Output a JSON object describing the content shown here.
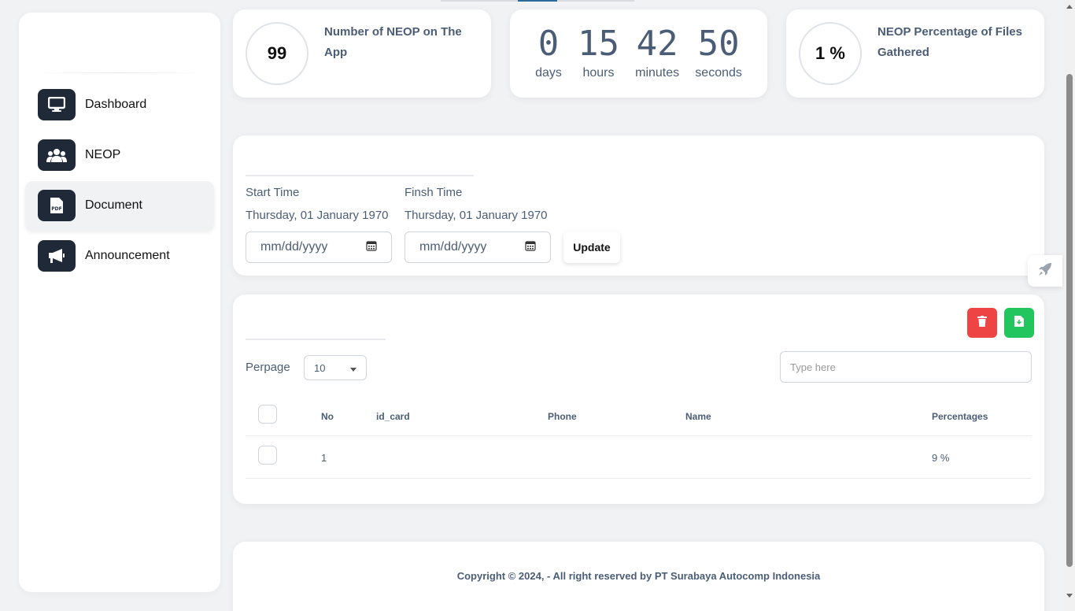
{
  "sidebar": {
    "items": [
      {
        "label": "Dashboard",
        "icon": "monitor-icon"
      },
      {
        "label": "NEOP",
        "icon": "users-icon"
      },
      {
        "label": "Document",
        "icon": "pdf-file-icon",
        "active": true
      },
      {
        "label": "Announcement",
        "icon": "megaphone-icon"
      }
    ]
  },
  "stats": {
    "neop_count": "99",
    "neop_count_title": "Number of NEOP on The App",
    "percentage": "1 %",
    "percentage_title": "NEOP Percentage of Files Gathered"
  },
  "countdown": {
    "days": "0",
    "days_label": "days",
    "hours": "15",
    "hours_label": "hours",
    "minutes": "42",
    "minutes_label": "minutes",
    "seconds": "50",
    "seconds_label": "seconds"
  },
  "filter": {
    "start_label": "Start Time",
    "start_value": "Thursday, 01 January 1970",
    "finish_label": "Finsh Time",
    "finish_value": "Thursday, 01 January 1970",
    "start_placeholder": "mm/dd/yyyy",
    "finish_placeholder": "mm/dd/yyyy",
    "update_label": "Update"
  },
  "table": {
    "perpage_label": "Perpage",
    "perpage_value": "10",
    "search_placeholder": "Type here",
    "columns": [
      "No",
      "id_card",
      "Phone",
      "Name",
      "Percentages"
    ],
    "rows": [
      {
        "no": "1",
        "id_card": "",
        "phone": "",
        "name": "",
        "percentage": "9 %"
      }
    ]
  },
  "footer": {
    "copyright": "Copyright © 2024, - All right reserved by PT Surabaya Autocomp Indonesia"
  },
  "colors": {
    "delete_button": "#ef4444",
    "export_button": "#22c55e",
    "nav_icon_bg": "#1f2937"
  }
}
